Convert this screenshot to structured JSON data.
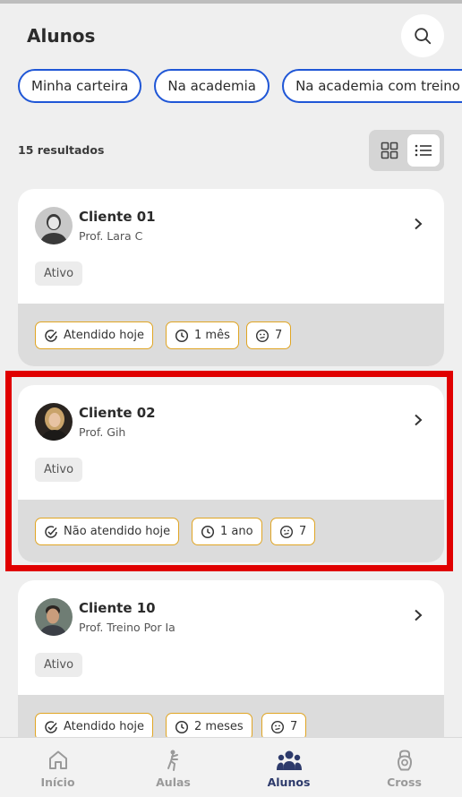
{
  "header": {
    "title": "Alunos"
  },
  "filters": [
    {
      "label": "Minha carteira"
    },
    {
      "label": "Na academia"
    },
    {
      "label": "Na academia com treino ou"
    }
  ],
  "results": {
    "count_text": "15 resultados"
  },
  "cards": [
    {
      "name": "Cliente 01",
      "prof": "Prof. Lara C",
      "status": "Ativo",
      "tags": {
        "attendance": "Atendido hoje",
        "duration": "1 mês",
        "mood": "7"
      }
    },
    {
      "name": "Cliente 02",
      "prof": "Prof. Gih",
      "status": "Ativo",
      "tags": {
        "attendance": "Não atendido hoje",
        "duration": "1 ano",
        "mood": "7"
      }
    },
    {
      "name": "Cliente 10",
      "prof": "Prof. Treino Por Ia",
      "status": "Ativo",
      "tags": {
        "attendance": "Atendido hoje",
        "duration": "2 meses",
        "mood": "7"
      }
    }
  ],
  "nav": [
    {
      "label": "Início",
      "icon": "home-icon"
    },
    {
      "label": "Aulas",
      "icon": "exercise-icon"
    },
    {
      "label": "Alunos",
      "icon": "people-icon",
      "active": true
    },
    {
      "label": "Cross",
      "icon": "kettlebell-icon"
    }
  ],
  "colors": {
    "accent_blue": "#1f56d6",
    "tag_border": "#e0a523",
    "highlight": "#e00000",
    "nav_active": "#2d3a6b"
  }
}
